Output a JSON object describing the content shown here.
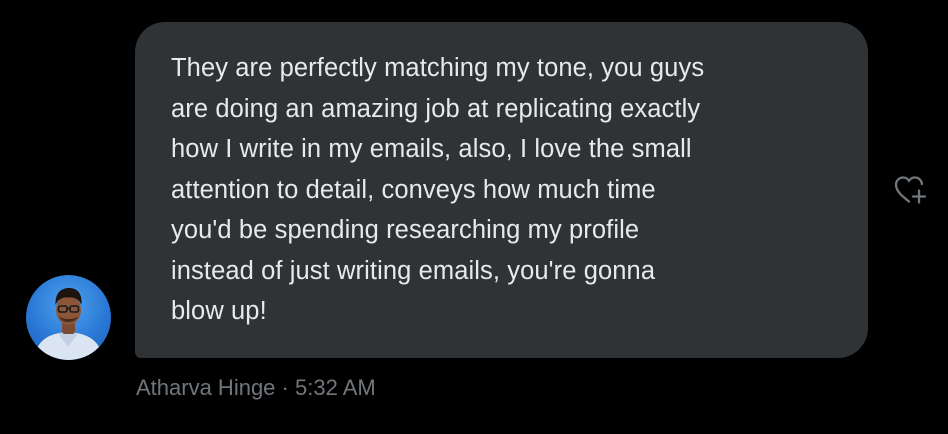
{
  "message": {
    "lines": [
      "They are perfectly matching my tone, you guys",
      "are doing an amazing job at replicating exactly",
      "how I write in my emails, also, I love the small",
      "attention to detail, conveys how much time",
      "you'd be spending researching my profile",
      "instead of just writing emails, you're gonna",
      "blow up!"
    ],
    "sender": "Atharva Hinge",
    "separator": " · ",
    "time": "5:32 AM"
  },
  "icons": {
    "avatar": "user-avatar",
    "reaction": "heart-plus-icon"
  },
  "colors": {
    "background": "#000000",
    "bubble": "#2f3336",
    "text": "#e7e9ea",
    "meta": "#71767b"
  }
}
